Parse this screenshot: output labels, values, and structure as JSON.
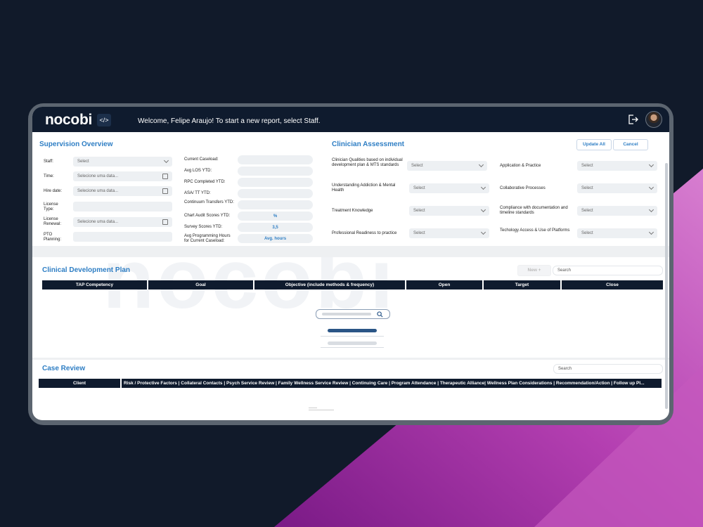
{
  "app": {
    "logo": "nocobi",
    "logo_mark": "</>",
    "welcome": "Welcome, Felipe Araujo! To start a new report, select Staff.",
    "icons": {
      "logout": "logout-icon",
      "avatar": "user-avatar"
    },
    "watermark": "nocobi"
  },
  "supervision": {
    "title": "Supervision Overview",
    "fields": [
      {
        "label": "Staff:",
        "value": "Select"
      },
      {
        "label": "Time:",
        "value": "Selecione uma data..."
      },
      {
        "label": "Hire date:",
        "value": "Selecione uma data..."
      },
      {
        "label": "License Type:",
        "value": ""
      },
      {
        "label": "License Renewal:",
        "value": "Selecione uma data..."
      },
      {
        "label": "PTO Planning:",
        "value": ""
      }
    ],
    "metrics": [
      {
        "label": "Current Caseload:",
        "value": ""
      },
      {
        "label": "Avg LOS YTD:",
        "value": ""
      },
      {
        "label": "RPC Completed YTD:",
        "value": ""
      },
      {
        "label": "ASA/ TT YTD:",
        "value": ""
      },
      {
        "label": "Continuum Transfers YTD:",
        "value": ""
      },
      {
        "label": "Chart Audit Scores YTD:",
        "value": "%"
      },
      {
        "label": "Survey Scores YTD:",
        "value": "3,5"
      },
      {
        "label": "Avg Programming Hours for Current Caseload:",
        "value": "Avg. hours"
      }
    ]
  },
  "assessment": {
    "title": "Clinician Assessment",
    "update_all": "Update All",
    "cancel": "Cancel",
    "left": [
      {
        "label": "Clinician Qualities based on individual development plan & MTS standards",
        "value": "Select"
      },
      {
        "label": "Understanding Addiction & Mental Health",
        "value": "Select"
      },
      {
        "label": "Treatment Knowledge",
        "value": "Select"
      },
      {
        "label": "Professional Readiness to practice",
        "value": "Select"
      }
    ],
    "right": [
      {
        "label": "Application & Practice",
        "value": "Select"
      },
      {
        "label": "Collaborative Processes",
        "value": "Select"
      },
      {
        "label": "Compliance with documentation and timeline standards",
        "value": "Select"
      },
      {
        "label": "Techology Access & Use of Platforms",
        "value": "Select"
      }
    ]
  },
  "cdp": {
    "title": "Clinical Development Plan",
    "new_button": "New +",
    "search_placeholder": "Search",
    "columns": [
      "TAP Competency",
      "Goal",
      "Objective (include methods & frequency)",
      "Open",
      "Target",
      "Close"
    ]
  },
  "case_review": {
    "title": "Case Review",
    "search_placeholder": "Search",
    "columns": [
      "Client",
      "Risk / Protective Factors | Collateral Contacts  | Psych Service Review    | Family Wellness Service Review | Continuing Care | Program Attendance | Therapeutic Alliance|  Wellness Plan Considerations | Recommendation/Action | Follow up Pl..."
    ]
  }
}
